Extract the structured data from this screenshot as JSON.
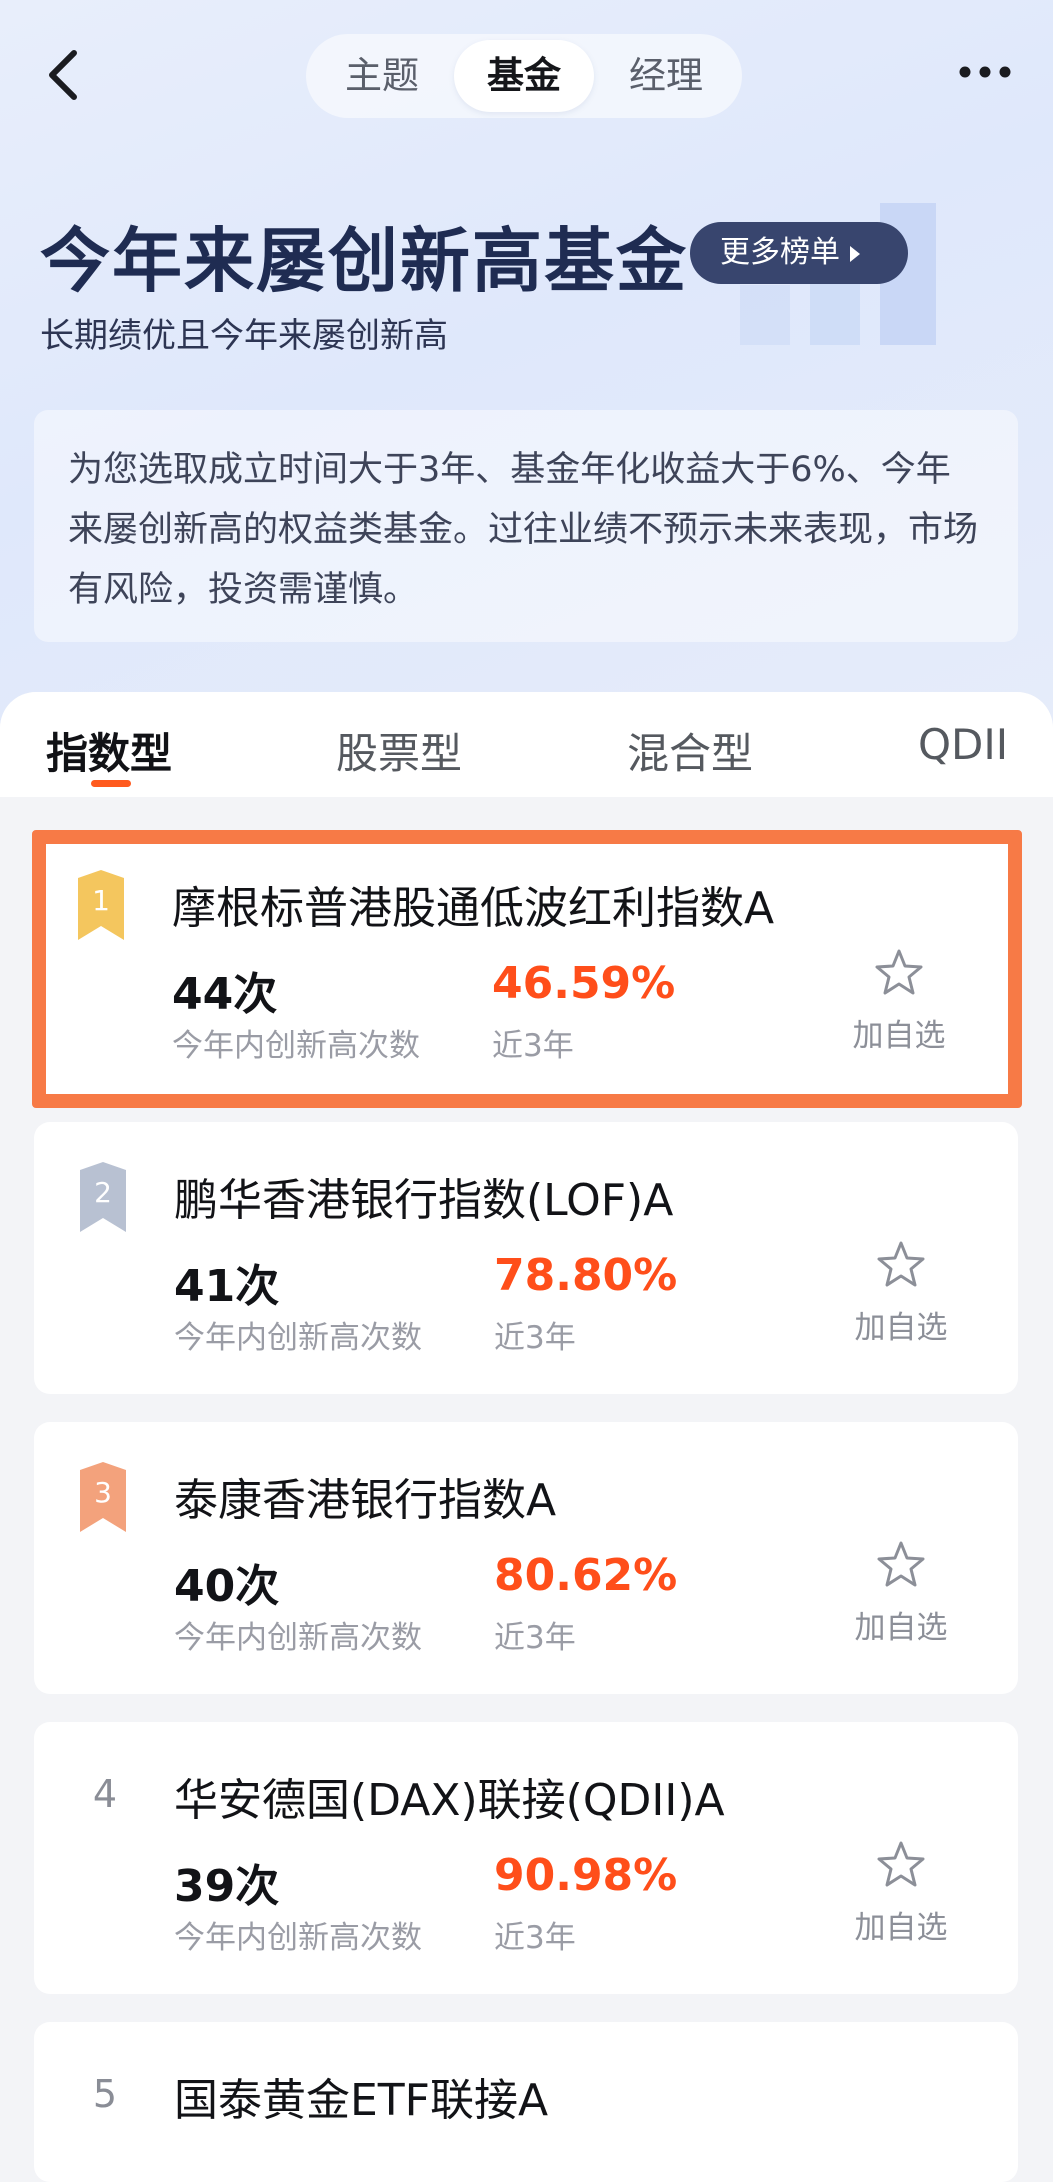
{
  "nav": {
    "segments": [
      "主题",
      "基金",
      "经理"
    ],
    "active_segment": "基金"
  },
  "header": {
    "title": "今年来屡创新高基金",
    "more_button": "更多榜单",
    "subtitle": "长期绩优且今年来屡创新高",
    "description": "为您选取成立时间大于3年、基金年化收益大于6%、今年来屡创新高的权益类基金。过往业绩不预示未来表现，市场有风险，投资需谨慎。"
  },
  "tabs": [
    "指数型",
    "股票型",
    "混合型",
    "QDII"
  ],
  "active_tab": "指数型",
  "count_label": "今年内创新高次数",
  "return_label": "近3年",
  "fav_label": "加自选",
  "colors": {
    "accent": "#ff4e1a",
    "highlight_border": "#f77a46",
    "gold": "#f4c65e",
    "silver": "#b8c1d2",
    "bronze": "#f3a27c",
    "more_button_bg": "#38456e"
  },
  "funds": [
    {
      "rank": "1",
      "name": "摩根标普港股通低波红利指数A",
      "count": "44次",
      "return": "46.59%",
      "badge": "gold-medal-icon"
    },
    {
      "rank": "2",
      "name": "鹏华香港银行指数(LOF)A",
      "count": "41次",
      "return": "78.80%",
      "badge": "silver-medal-icon"
    },
    {
      "rank": "3",
      "name": "泰康香港银行指数A",
      "count": "40次",
      "return": "80.62%",
      "badge": "bronze-medal-icon"
    },
    {
      "rank": "4",
      "name": "华安德国(DAX)联接(QDII)A",
      "count": "39次",
      "return": "90.98%"
    },
    {
      "rank": "5",
      "name": "国泰黄金ETF联接A"
    }
  ]
}
